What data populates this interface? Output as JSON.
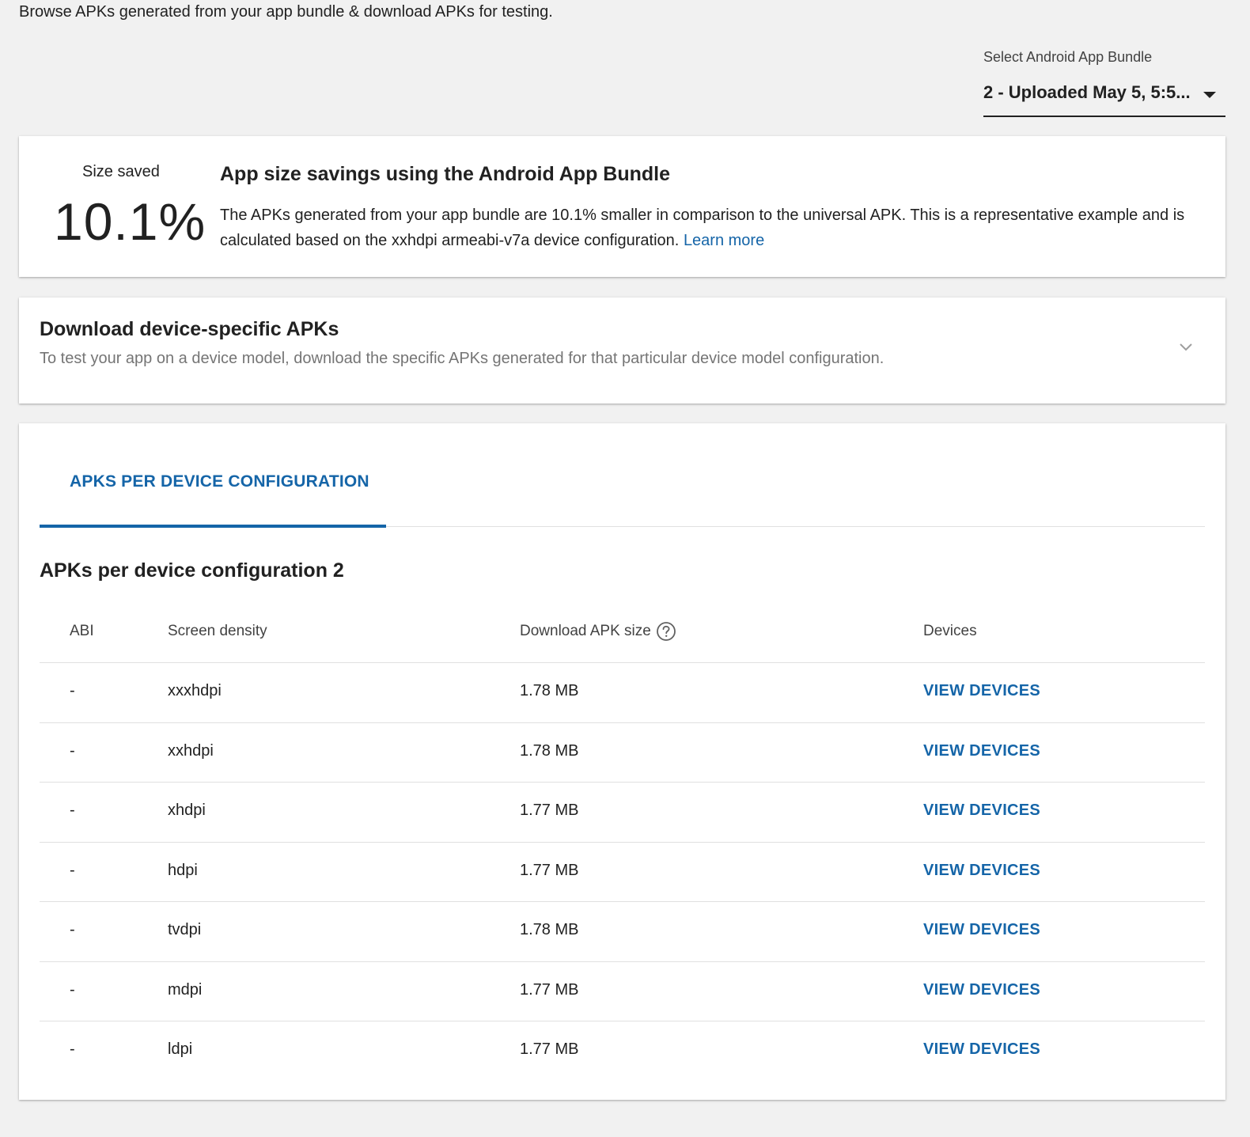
{
  "intro": "Browse APKs generated from your app bundle & download APKs for testing.",
  "bundle_select": {
    "label": "Select Android App Bundle",
    "value": "2 - Uploaded May 5, 5:5..."
  },
  "savings": {
    "label": "Size saved",
    "value": "10.1%",
    "title": "App size savings using the Android App Bundle",
    "description": "The APKs generated from your app bundle are 10.1% smaller in comparison to the universal APK. This is a representative example and is calculated based on the xxhdpi armeabi-v7a device configuration.",
    "learn_more": "Learn more"
  },
  "download": {
    "title": "Download device-specific APKs",
    "description": "To test your app on a device model, download the specific APKs generated for that particular device model configuration."
  },
  "apks": {
    "tab_label": "APKS PER DEVICE CONFIGURATION",
    "section_title": "APKs per device configuration 2",
    "columns": {
      "abi": "ABI",
      "density": "Screen density",
      "size": "Download APK size",
      "devices": "Devices"
    },
    "rows": [
      {
        "abi": "-",
        "density": "xxxhdpi",
        "size": "1.78 MB",
        "action": "VIEW DEVICES"
      },
      {
        "abi": "-",
        "density": "xxhdpi",
        "size": "1.78 MB",
        "action": "VIEW DEVICES"
      },
      {
        "abi": "-",
        "density": "xhdpi",
        "size": "1.77 MB",
        "action": "VIEW DEVICES"
      },
      {
        "abi": "-",
        "density": "hdpi",
        "size": "1.77 MB",
        "action": "VIEW DEVICES"
      },
      {
        "abi": "-",
        "density": "tvdpi",
        "size": "1.78 MB",
        "action": "VIEW DEVICES"
      },
      {
        "abi": "-",
        "density": "mdpi",
        "size": "1.77 MB",
        "action": "VIEW DEVICES"
      },
      {
        "abi": "-",
        "density": "ldpi",
        "size": "1.77 MB",
        "action": "VIEW DEVICES"
      }
    ]
  },
  "colors": {
    "accent": "#1565a8",
    "background": "#f1f1f1",
    "card": "#ffffff",
    "muted_text": "#757575"
  },
  "icons": {
    "dropdown": "caret-down-icon",
    "expand": "chevron-down-icon",
    "help": "question-circle-icon"
  }
}
